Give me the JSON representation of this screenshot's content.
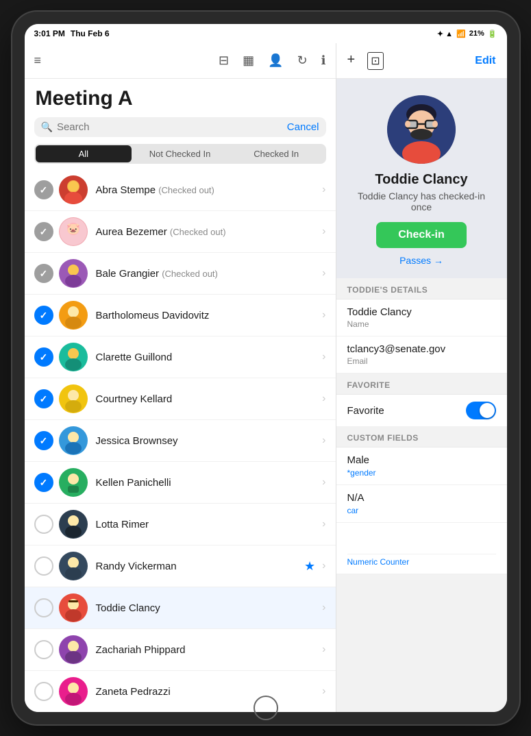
{
  "statusBar": {
    "time": "3:01 PM",
    "date": "Thu Feb 6",
    "battery": "21%"
  },
  "leftPanel": {
    "toolbar": {
      "menuIcon": "≡",
      "filterIcon": "⊟",
      "barcodeIcon": "▦",
      "personIcon": "👤",
      "refreshIcon": "↻",
      "infoIcon": "ℹ"
    },
    "title": "Meeting A",
    "search": {
      "placeholder": "Search",
      "cancelLabel": "Cancel"
    },
    "tabs": [
      {
        "label": "All",
        "active": true
      },
      {
        "label": "Not Checked In",
        "active": false
      },
      {
        "label": "Checked In",
        "active": false
      }
    ],
    "attendees": [
      {
        "name": "Abra Stempe",
        "status": "Checked out",
        "checkState": "checked-out",
        "avatarColor": "#e74c3c",
        "avatarEmoji": "👩"
      },
      {
        "name": "Aurea Bezemer",
        "status": "Checked out",
        "checkState": "checked-out",
        "avatarColor": "#e67e22",
        "avatarEmoji": "🐷"
      },
      {
        "name": "Bale Grangier",
        "status": "Checked out",
        "checkState": "checked-out",
        "avatarColor": "#9b59b6",
        "avatarEmoji": "👩"
      },
      {
        "name": "Bartholomeus Davidovitz",
        "status": "",
        "checkState": "checked-in",
        "avatarColor": "#f39c12",
        "avatarEmoji": "👦"
      },
      {
        "name": "Clarette Guillond",
        "status": "",
        "checkState": "checked-in",
        "avatarColor": "#1abc9c",
        "avatarEmoji": "👩"
      },
      {
        "name": "Courtney Kellard",
        "status": "",
        "checkState": "checked-in",
        "avatarColor": "#f1c40f",
        "avatarEmoji": "👱"
      },
      {
        "name": "Jessica Brownsey",
        "status": "",
        "checkState": "checked-in",
        "avatarColor": "#3498db",
        "avatarEmoji": "👩"
      },
      {
        "name": "Kellen Panichelli",
        "status": "",
        "checkState": "checked-in",
        "avatarColor": "#27ae60",
        "avatarEmoji": "🧔"
      },
      {
        "name": "Lotta Rimer",
        "status": "",
        "checkState": "unchecked",
        "avatarColor": "#2c3e50",
        "avatarEmoji": "👩"
      },
      {
        "name": "Randy Vickerman",
        "status": "",
        "checkState": "unchecked",
        "avatarColor": "#34495e",
        "avatarEmoji": "👨",
        "starred": true
      },
      {
        "name": "Toddie Clancy",
        "status": "",
        "checkState": "unchecked",
        "avatarColor": "#e74c3c",
        "avatarEmoji": "👨",
        "selected": true
      },
      {
        "name": "Zachariah Phippard",
        "status": "",
        "checkState": "unchecked",
        "avatarColor": "#8e44ad",
        "avatarEmoji": "👨"
      },
      {
        "name": "Zaneta Pedrazzi",
        "status": "",
        "checkState": "unchecked",
        "avatarColor": "#e91e8c",
        "avatarEmoji": "👩"
      }
    ]
  },
  "rightPanel": {
    "toolbar": {
      "addIcon": "+",
      "scanIcon": "⊡",
      "editLabel": "Edit"
    },
    "profile": {
      "name": "Toddie Clancy",
      "statusText": "Toddie Clancy has checked-in once",
      "checkinLabel": "Check-in",
      "passesLabel": "Passes →"
    },
    "detailsSection": {
      "header": "TODDIE'S DETAILS",
      "name": {
        "value": "Toddie Clancy",
        "label": "Name"
      },
      "email": {
        "value": "tclancy3@senate.gov",
        "label": "Email"
      }
    },
    "favoriteSection": {
      "header": "FAVORITE",
      "label": "Favorite",
      "enabled": true
    },
    "customFieldsSection": {
      "header": "CUSTOM FIELDS",
      "fields": [
        {
          "value": "Male",
          "label": "*gender"
        },
        {
          "value": "N/A",
          "label": "car"
        },
        {
          "value": "",
          "label": "Numeric Counter"
        }
      ]
    }
  }
}
